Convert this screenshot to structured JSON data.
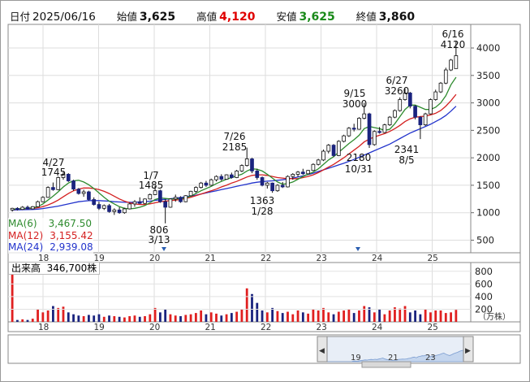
{
  "header": {
    "date_label": "日付",
    "date_value": "2025/06/16",
    "open_label": "始値",
    "open_value": "3,625",
    "high_label": "高値",
    "high_value": "4,120",
    "low_label": "安値",
    "low_value": "3,625",
    "close_label": "終値",
    "close_value": "3,860"
  },
  "colors": {
    "up": "#ffffff",
    "down": "#1a237e",
    "ma6": "#2e8b2e",
    "ma12": "#d42020",
    "ma24": "#2233cc",
    "vol_up": "#e02020",
    "vol_down": "#1a237e",
    "high_text": "#e00000",
    "low_text": "#1a8a1a",
    "nav_fill": "#c5d6ee"
  },
  "legend": {
    "ma6_label": "MA(6)",
    "ma6_value": "3,467.50",
    "ma12_label": "MA(12)",
    "ma12_value": "3,155.42",
    "ma24_label": "MA(24)",
    "ma24_value": "2,939.08"
  },
  "volume": {
    "title": "出来高",
    "value": "346,700株",
    "unit": "（万株）",
    "y_ticks": [
      "800",
      "600",
      "400",
      "200"
    ]
  },
  "price_axis": {
    "ticks": [
      "4000",
      "3500",
      "3000",
      "2500",
      "2000",
      "1500",
      "1000",
      "500"
    ]
  },
  "x_axis": {
    "labels": [
      "18",
      "19",
      "20",
      "21",
      "22",
      "23",
      "24",
      "25"
    ]
  },
  "navigator": {
    "labels": [
      "19",
      "21",
      "23"
    ],
    "left_arrow": "◀",
    "right_arrow": "▶"
  },
  "chart_data": {
    "type": "candlestick",
    "ylim": [
      300,
      4400
    ],
    "annotations": [
      {
        "date": "4/27",
        "value": "1745"
      },
      {
        "date": "1/7",
        "value": "1485"
      },
      {
        "date": "3/13",
        "value": "806"
      },
      {
        "date": "7/26",
        "value": "2185"
      },
      {
        "date": "1/28",
        "value": "1363"
      },
      {
        "date": "9/15",
        "value": "3000"
      },
      {
        "date": "10/31",
        "value": "2180"
      },
      {
        "date": "6/27",
        "value": "3260"
      },
      {
        "date": "8/5",
        "value": "2341"
      },
      {
        "date": "6/16",
        "value": "4120"
      }
    ],
    "candles": [
      [
        1050,
        1090,
        1020,
        1080
      ],
      [
        1080,
        1100,
        1040,
        1060
      ],
      [
        1060,
        1120,
        1050,
        1100
      ],
      [
        1100,
        1130,
        1060,
        1070
      ],
      [
        1070,
        1120,
        1060,
        1110
      ],
      [
        1110,
        1220,
        1100,
        1200
      ],
      [
        1200,
        1300,
        1190,
        1280
      ],
      [
        1280,
        1480,
        1270,
        1460
      ],
      [
        1460,
        1550,
        1400,
        1420
      ],
      [
        1420,
        1660,
        1410,
        1640
      ],
      [
        1640,
        1745,
        1600,
        1700
      ],
      [
        1700,
        1720,
        1560,
        1580
      ],
      [
        1580,
        1600,
        1400,
        1430
      ],
      [
        1430,
        1450,
        1330,
        1350
      ],
      [
        1350,
        1420,
        1290,
        1380
      ],
      [
        1380,
        1400,
        1220,
        1240
      ],
      [
        1240,
        1280,
        1130,
        1150
      ],
      [
        1150,
        1200,
        1050,
        1080
      ],
      [
        1080,
        1150,
        1050,
        1130
      ],
      [
        1130,
        1160,
        1000,
        1020
      ],
      [
        1020,
        1080,
        960,
        1050
      ],
      [
        1050,
        1100,
        980,
        1000
      ],
      [
        1000,
        1090,
        980,
        1070
      ],
      [
        1070,
        1180,
        1060,
        1160
      ],
      [
        1160,
        1230,
        1110,
        1200
      ],
      [
        1200,
        1280,
        1160,
        1170
      ],
      [
        1170,
        1260,
        1160,
        1250
      ],
      [
        1250,
        1350,
        1240,
        1330
      ],
      [
        1330,
        1485,
        1320,
        1400
      ],
      [
        1400,
        1420,
        1180,
        1200
      ],
      [
        1200,
        1250,
        806,
        1100
      ],
      [
        1100,
        1260,
        1090,
        1250
      ],
      [
        1250,
        1330,
        1200,
        1280
      ],
      [
        1280,
        1300,
        1180,
        1200
      ],
      [
        1200,
        1320,
        1190,
        1310
      ],
      [
        1310,
        1400,
        1300,
        1390
      ],
      [
        1390,
        1480,
        1360,
        1460
      ],
      [
        1460,
        1560,
        1440,
        1540
      ],
      [
        1540,
        1580,
        1470,
        1500
      ],
      [
        1500,
        1620,
        1490,
        1600
      ],
      [
        1600,
        1680,
        1570,
        1660
      ],
      [
        1660,
        1700,
        1580,
        1610
      ],
      [
        1610,
        1700,
        1600,
        1690
      ],
      [
        1690,
        1730,
        1620,
        1640
      ],
      [
        1640,
        1780,
        1630,
        1760
      ],
      [
        1760,
        1880,
        1740,
        1860
      ],
      [
        1860,
        2185,
        1840,
        1980
      ],
      [
        1980,
        2000,
        1720,
        1760
      ],
      [
        1760,
        1800,
        1600,
        1640
      ],
      [
        1640,
        1660,
        1480,
        1500
      ],
      [
        1500,
        1560,
        1440,
        1540
      ],
      [
        1540,
        1550,
        1363,
        1400
      ],
      [
        1400,
        1520,
        1380,
        1500
      ],
      [
        1500,
        1560,
        1450,
        1470
      ],
      [
        1470,
        1680,
        1460,
        1660
      ],
      [
        1660,
        1720,
        1600,
        1700
      ],
      [
        1700,
        1760,
        1650,
        1740
      ],
      [
        1740,
        1800,
        1690,
        1710
      ],
      [
        1710,
        1780,
        1700,
        1770
      ],
      [
        1770,
        1900,
        1760,
        1880
      ],
      [
        1880,
        1980,
        1860,
        1960
      ],
      [
        1960,
        2150,
        1940,
        2120
      ],
      [
        2120,
        2250,
        2080,
        2230
      ],
      [
        2230,
        2250,
        2020,
        2040
      ],
      [
        2040,
        2320,
        2030,
        2300
      ],
      [
        2300,
        2420,
        2280,
        2400
      ],
      [
        2400,
        2560,
        2380,
        2540
      ],
      [
        2540,
        2620,
        2480,
        2520
      ],
      [
        2520,
        2740,
        2510,
        2720
      ],
      [
        2720,
        3000,
        2700,
        2800
      ],
      [
        2800,
        2820,
        2180,
        2240
      ],
      [
        2240,
        2500,
        2220,
        2480
      ],
      [
        2480,
        2560,
        2440,
        2460
      ],
      [
        2460,
        2620,
        2450,
        2600
      ],
      [
        2600,
        2760,
        2580,
        2740
      ],
      [
        2740,
        2880,
        2720,
        2860
      ],
      [
        2860,
        3100,
        2840,
        3060
      ],
      [
        3060,
        3260,
        3040,
        3180
      ],
      [
        3180,
        3200,
        2900,
        2940
      ],
      [
        2940,
        2960,
        2700,
        2740
      ],
      [
        2740,
        2760,
        2341,
        2600
      ],
      [
        2600,
        2820,
        2580,
        2800
      ],
      [
        2800,
        3080,
        2790,
        3060
      ],
      [
        3060,
        3240,
        3040,
        3200
      ],
      [
        3200,
        3380,
        3180,
        3360
      ],
      [
        3360,
        3640,
        3340,
        3600
      ],
      [
        3600,
        3800,
        3580,
        3780
      ],
      [
        3625,
        4120,
        3625,
        3860
      ]
    ],
    "ma6": [
      1060,
      1070,
      1075,
      1080,
      1090,
      1110,
      1160,
      1230,
      1300,
      1380,
      1470,
      1540,
      1580,
      1590,
      1560,
      1510,
      1440,
      1360,
      1280,
      1210,
      1160,
      1110,
      1080,
      1070,
      1080,
      1100,
      1130,
      1180,
      1240,
      1270,
      1260,
      1250,
      1250,
      1260,
      1270,
      1300,
      1350,
      1400,
      1440,
      1480,
      1530,
      1570,
      1610,
      1640,
      1670,
      1700,
      1760,
      1800,
      1790,
      1760,
      1700,
      1630,
      1560,
      1520,
      1530,
      1560,
      1610,
      1660,
      1700,
      1740,
      1800,
      1880,
      1960,
      2020,
      2100,
      2180,
      2260,
      2330,
      2410,
      2530,
      2570,
      2550,
      2530,
      2500,
      2520,
      2620,
      2750,
      2880,
      2960,
      2960,
      2920,
      2880,
      2880,
      2920,
      3000,
      3130,
      3330,
      3467
    ],
    "ma12": [
      1060,
      1065,
      1070,
      1075,
      1080,
      1090,
      1110,
      1140,
      1180,
      1230,
      1290,
      1350,
      1400,
      1430,
      1450,
      1450,
      1440,
      1420,
      1390,
      1350,
      1300,
      1250,
      1210,
      1180,
      1160,
      1150,
      1150,
      1160,
      1180,
      1200,
      1210,
      1220,
      1230,
      1240,
      1260,
      1280,
      1310,
      1340,
      1370,
      1400,
      1430,
      1470,
      1500,
      1540,
      1570,
      1610,
      1650,
      1680,
      1690,
      1690,
      1680,
      1660,
      1640,
      1630,
      1620,
      1620,
      1620,
      1640,
      1660,
      1690,
      1730,
      1780,
      1830,
      1880,
      1940,
      2000,
      2070,
      2140,
      2210,
      2290,
      2340,
      2380,
      2410,
      2440,
      2480,
      2530,
      2590,
      2660,
      2710,
      2740,
      2750,
      2760,
      2780,
      2810,
      2860,
      2940,
      3040,
      3155
    ],
    "ma24": [
      1050,
      1052,
      1055,
      1058,
      1060,
      1065,
      1075,
      1090,
      1105,
      1120,
      1140,
      1160,
      1180,
      1200,
      1210,
      1220,
      1220,
      1220,
      1215,
      1210,
      1200,
      1195,
      1190,
      1190,
      1190,
      1195,
      1200,
      1210,
      1225,
      1235,
      1245,
      1255,
      1265,
      1275,
      1290,
      1305,
      1320,
      1340,
      1360,
      1380,
      1400,
      1420,
      1440,
      1460,
      1480,
      1500,
      1520,
      1540,
      1555,
      1565,
      1575,
      1580,
      1590,
      1600,
      1615,
      1630,
      1650,
      1670,
      1695,
      1720,
      1750,
      1780,
      1810,
      1840,
      1870,
      1900,
      1935,
      1970,
      2010,
      2050,
      2090,
      2130,
      2170,
      2210,
      2250,
      2300,
      2350,
      2400,
      2450,
      2490,
      2530,
      2570,
      2610,
      2660,
      2710,
      2770,
      2850,
      2939
    ],
    "volume": [
      5,
      3,
      4,
      3,
      5,
      20,
      15,
      18,
      25,
      22,
      24,
      15,
      12,
      10,
      9,
      11,
      10,
      12,
      8,
      10,
      9,
      8,
      7,
      9,
      10,
      8,
      9,
      12,
      22,
      15,
      20,
      12,
      10,
      9,
      11,
      12,
      14,
      18,
      12,
      15,
      13,
      10,
      12,
      14,
      16,
      20,
      53,
      44,
      30,
      18,
      15,
      22,
      17,
      14,
      16,
      12,
      18,
      15,
      13,
      20,
      18,
      22,
      15,
      12,
      16,
      18,
      20,
      14,
      18,
      25,
      23,
      15,
      20,
      12,
      18,
      23,
      21,
      25,
      15,
      18,
      12,
      20,
      15,
      18,
      18,
      14,
      15,
      19
    ],
    "vol_first": 80,
    "vol_ylim": [
      0,
      900
    ]
  }
}
